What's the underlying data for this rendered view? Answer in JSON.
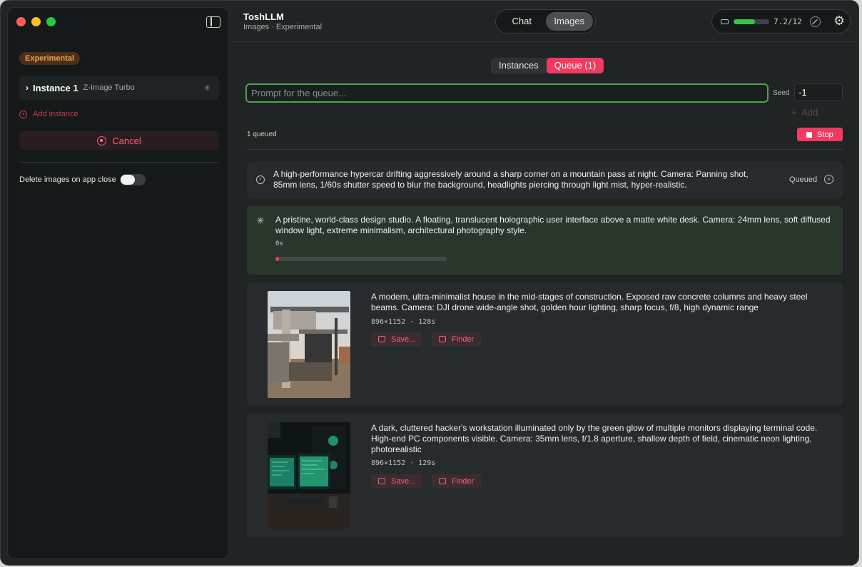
{
  "sidebar": {
    "badge": "Experimental",
    "instance": {
      "name": "Instance 1",
      "model": "Z-Image Turbo"
    },
    "add_instance": "Add instance",
    "cancel": "Cancel",
    "delete_label": "Delete images on app close",
    "delete_toggle_on": false
  },
  "header": {
    "title": "ToshLLM",
    "subtitle": "Images · Experimental",
    "tabs": [
      "Chat",
      "Images"
    ],
    "active_tab": "Images",
    "memory_text": "7.2/12",
    "memory_fraction": 0.6,
    "memory_color": "#38c448"
  },
  "main": {
    "subtabs": [
      "Instances",
      "Queue (1)"
    ],
    "active_subtab": "Queue (1)",
    "prompt_placeholder": "Prompt for the queue...",
    "seed_label": "Seed",
    "seed_value": "-1",
    "add_label": "Add",
    "queued_count": "1 queued",
    "stop_label": "Stop",
    "accent": "#f03a5f",
    "queued_item": {
      "text": "A high-performance hypercar drifting aggressively around a sharp corner on a mountain pass at night. Camera: Panning shot, 85mm lens, 1/60s shutter speed to blur the background, headlights piercing through light mist, hyper-realistic.",
      "state": "Queued"
    },
    "running_item": {
      "text": "A pristine, world-class design studio. A floating, translucent holographic user interface above a matte white desk. Camera: 24mm lens, soft diffused window light, extreme minimalism, architectural photography style.",
      "elapsed": "0s",
      "progress": 0.02
    },
    "results": [
      {
        "text": "A modern, ultra-minimalist house in the mid-stages of construction. Exposed raw concrete columns and heavy steel beams. Camera: DJI drone wide-angle shot, golden hour lighting, sharp focus, f/8, high dynamic range",
        "meta": "896×1152 · 128s",
        "save": "Save...",
        "finder": "Finder"
      },
      {
        "text": "A dark, cluttered hacker's workstation illuminated only by the green glow of multiple monitors displaying terminal code. High-end PC components visible. Camera: 35mm lens, f/1.8 aperture, shallow depth of field, cinematic neon lighting, photorealistic",
        "meta": "896×1152 · 129s",
        "save": "Save...",
        "finder": "Finder"
      }
    ]
  }
}
